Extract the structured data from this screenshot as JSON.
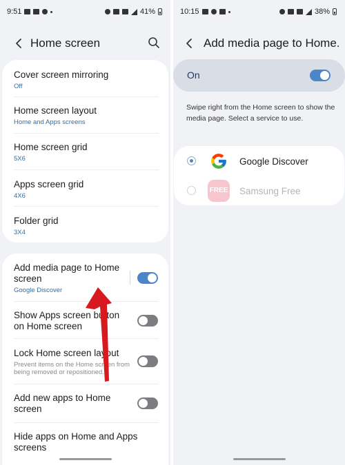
{
  "left": {
    "status": {
      "time": "9:51",
      "battery": "41%"
    },
    "title": "Home screen",
    "group1": [
      {
        "title": "Cover screen mirroring",
        "sub": "Off"
      },
      {
        "title": "Home screen layout",
        "sub": "Home and Apps screens"
      },
      {
        "title": "Home screen grid",
        "sub": "5X6"
      },
      {
        "title": "Apps screen grid",
        "sub": "4X6"
      },
      {
        "title": "Folder grid",
        "sub": "3X4"
      }
    ],
    "group2": [
      {
        "title": "Add media page to Home screen",
        "sub": "Google Discover",
        "toggle": "on"
      },
      {
        "title": "Show Apps screen button on Home screen",
        "toggle": "off"
      },
      {
        "title": "Lock Home screen layout",
        "sub": "Prevent items on the Home screen from being removed or repositioned.",
        "toggle": "off"
      },
      {
        "title": "Add new apps to Home screen",
        "toggle": "off"
      },
      {
        "title": "Hide apps on Home and Apps screens"
      }
    ]
  },
  "right": {
    "status": {
      "time": "10:15",
      "battery": "38%"
    },
    "title": "Add media page to Home...",
    "master_label": "On",
    "master_state": "on",
    "description": "Swipe right from the Home screen to show the media page. Select a service to use.",
    "services": [
      {
        "name": "Google Discover",
        "selected": true,
        "enabled": true,
        "logo_text": "G"
      },
      {
        "name": "Samsung Free",
        "selected": false,
        "enabled": false,
        "logo_text": "FREE"
      }
    ]
  },
  "colors": {
    "accent": "#4a86c8",
    "subtitle": "#2f6ea8",
    "arrow": "#d71920",
    "background": "#f1f2f6"
  }
}
